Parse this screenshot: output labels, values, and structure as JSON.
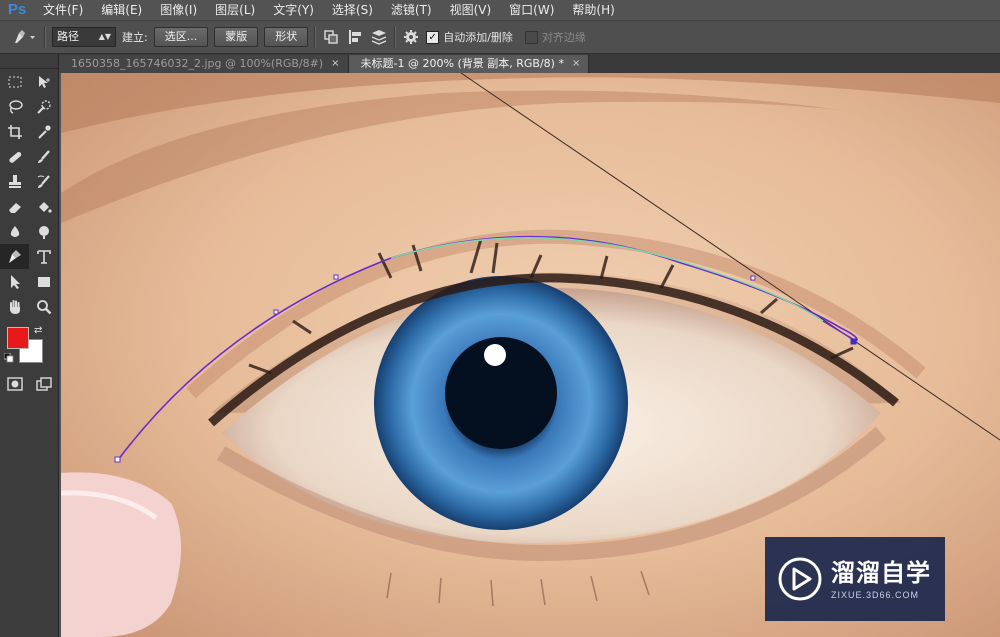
{
  "app": {
    "logo_text": "Ps"
  },
  "menu": [
    {
      "label": "文件(F)"
    },
    {
      "label": "编辑(E)"
    },
    {
      "label": "图像(I)"
    },
    {
      "label": "图层(L)"
    },
    {
      "label": "文字(Y)"
    },
    {
      "label": "选择(S)"
    },
    {
      "label": "滤镜(T)"
    },
    {
      "label": "视图(V)"
    },
    {
      "label": "窗口(W)"
    },
    {
      "label": "帮助(H)"
    }
  ],
  "options_bar": {
    "mode_select": "路径",
    "build_label": "建立:",
    "selection_button": "选区...",
    "mask_button": "蒙版",
    "shape_button": "形状",
    "auto_add_delete": {
      "label": "自动添加/删除",
      "checked": true
    },
    "align_edges": {
      "label": "对齐边缘",
      "checked": false
    }
  },
  "tabs": [
    {
      "label": "1650358_165746032_2.jpg @ 100%(RGB/8#)",
      "active": false,
      "close": "×"
    },
    {
      "label": "未标题-1 @ 200% (背景 副本, RGB/8) *",
      "active": true,
      "close": "×"
    }
  ],
  "colors": {
    "foreground": "#e8191a",
    "background": "#ffffff",
    "path_stroke": "#6a2cc8",
    "path_highlight": "#7fd6a8"
  },
  "tools": [
    [
      "marquee-tool",
      "move-tool"
    ],
    [
      "lasso-tool",
      "quick-selection-tool"
    ],
    [
      "crop-tool",
      "eyedropper-tool"
    ],
    [
      "healing-brush-tool",
      "brush-tool"
    ],
    [
      "clone-stamp-tool",
      "history-brush-tool"
    ],
    [
      "eraser-tool",
      "paint-bucket-tool"
    ],
    [
      "blur-tool",
      "dodge-tool"
    ],
    [
      "pen-tool",
      "type-tool"
    ],
    [
      "path-selection-tool",
      "rectangle-tool"
    ],
    [
      "hand-tool",
      "zoom-tool"
    ]
  ],
  "active_tool": "pen-tool",
  "watermark": {
    "title": "溜溜自学",
    "url": "ZIXUE.3D66.COM"
  }
}
